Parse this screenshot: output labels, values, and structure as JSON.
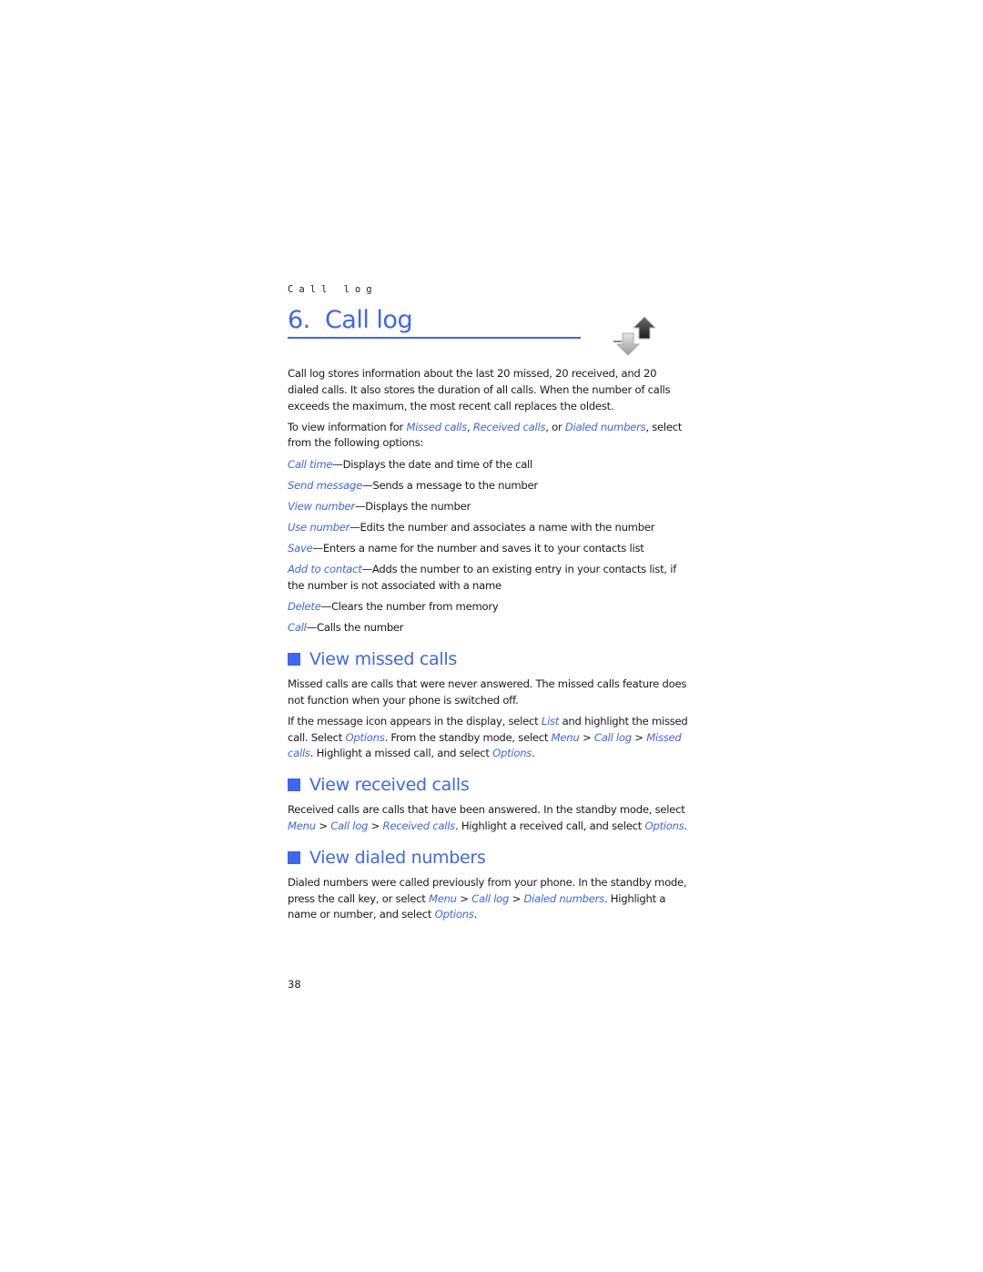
{
  "running_head": "Call log",
  "chapter": {
    "number": "6.",
    "title": "Call log",
    "icon": "call-log-arrows-icon"
  },
  "intro": [
    "Call log stores information about the last 20 missed, 20 received, and 20 dialed calls. It also stores the duration of all calls. When the number of calls exceeds the maximum, the most recent call replaces the oldest."
  ],
  "view_info": {
    "prefix": "To view information for ",
    "missed": "Missed calls",
    "sep1": ", ",
    "received": "Received calls",
    "sep2": ", or ",
    "dialed": "Dialed numbers",
    "suffix": ", select from the following options:"
  },
  "options": [
    {
      "term": "Call time",
      "desc": "—Displays the date and time of the call"
    },
    {
      "term": "Send message",
      "desc": "—Sends a message to the number"
    },
    {
      "term": "View number",
      "desc": "—Displays the number"
    },
    {
      "term": "Use number",
      "desc": "—Edits the number and associates a name with the number"
    },
    {
      "term": "Save",
      "desc": "—Enters a name for the number and saves it to your contacts list"
    },
    {
      "term": "Add to contact",
      "desc": "—Adds the number to an existing entry in your contacts list, if the number is not associated with a name"
    },
    {
      "term": "Delete",
      "desc": "—Clears the number from memory"
    },
    {
      "term": "Call",
      "desc": "—Calls the number"
    }
  ],
  "sections": {
    "missed": {
      "heading": "View missed calls",
      "p1": "Missed calls are calls that were never answered. The missed calls feature does not function when your phone is switched off.",
      "p2": {
        "t1": "If the message icon appears in the display, select ",
        "l1": "List",
        "t2": " and highlight the missed call. Select ",
        "l2": "Options",
        "t3": ". From the standby mode, select ",
        "l3": "Menu",
        "t4": " > ",
        "l4": "Call log",
        "t5": " > ",
        "l5": "Missed calls",
        "t6": ". Highlight a missed call, and select ",
        "l6": "Options",
        "t7": "."
      }
    },
    "received": {
      "heading": "View received calls",
      "p1": {
        "t1": "Received calls are calls that have been answered. In the standby mode, select ",
        "l1": "Menu",
        "t2": " > ",
        "l2": "Call log",
        "t3": " > ",
        "l3": "Received calls",
        "t4": ". Highlight a received call, and select ",
        "l4": "Options",
        "t5": "."
      }
    },
    "dialed": {
      "heading": "View dialed numbers",
      "p1": {
        "t1": "Dialed numbers were called previously from your phone. In the standby mode, press the call key, or select ",
        "l1": "Menu",
        "t2": " > ",
        "l2": "Call log",
        "t3": " > ",
        "l3": "Dialed numbers",
        "t4": ". Highlight a name or number, and select ",
        "l4": "Options",
        "t5": "."
      }
    }
  },
  "page_number": "38",
  "colors": {
    "accent": "#3d66f2",
    "text": "#1a1a1a"
  }
}
